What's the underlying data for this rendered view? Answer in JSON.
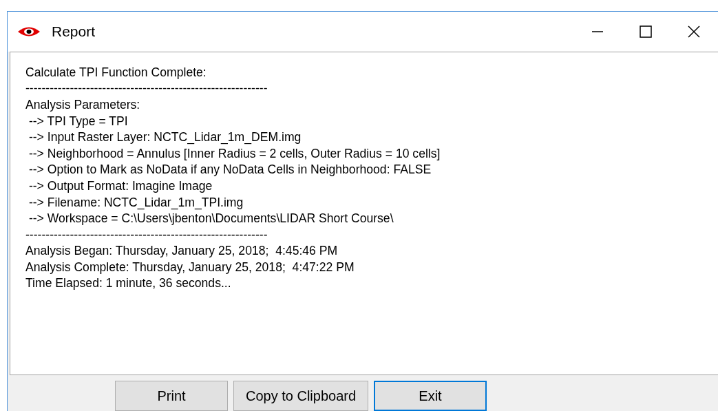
{
  "window": {
    "title": "Report"
  },
  "report_lines": [
    "Calculate TPI Function Complete:",
    "------------------------------------------------------------",
    "Analysis Parameters:",
    " --> TPI Type = TPI",
    " --> Input Raster Layer: NCTC_Lidar_1m_DEM.img",
    " --> Neighborhood = Annulus [Inner Radius = 2 cells, Outer Radius = 10 cells]",
    " --> Option to Mark as NoData if any NoData Cells in Neighborhood: FALSE",
    " --> Output Format: Imagine Image",
    " --> Filename: NCTC_Lidar_1m_TPI.img",
    " --> Workspace = C:\\Users\\jbenton\\Documents\\LIDAR Short Course\\",
    "------------------------------------------------------------",
    "Analysis Began: Thursday, January 25, 2018;  4:45:46 PM",
    "Analysis Complete: Thursday, January 25, 2018;  4:47:22 PM",
    "Time Elapsed: 1 minute, 36 seconds..."
  ],
  "buttons": [
    {
      "label": "Print",
      "default": false
    },
    {
      "label": "Copy to Clipboard",
      "default": false
    },
    {
      "label": "Exit",
      "default": true
    }
  ]
}
